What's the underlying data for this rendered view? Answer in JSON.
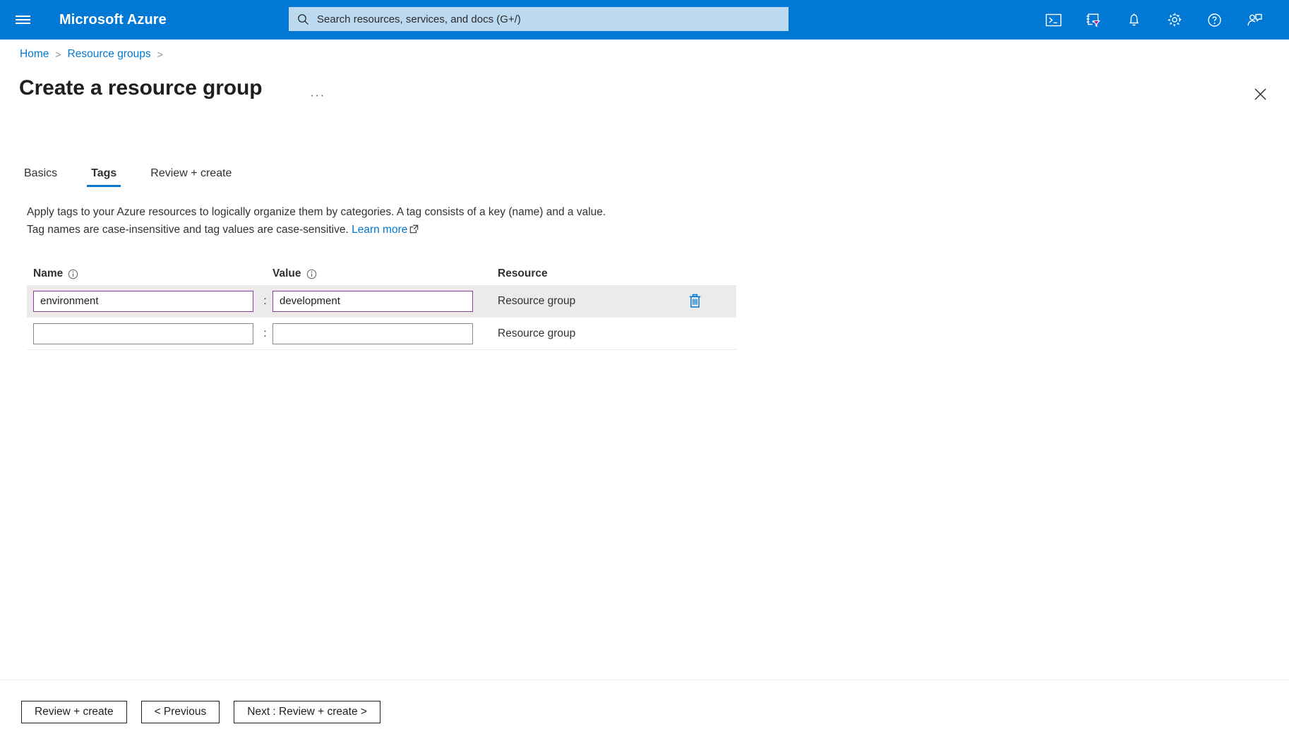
{
  "topbar": {
    "menu_icon": "hamburger-menu-icon",
    "brand": "Microsoft Azure",
    "search": {
      "icon": "search-icon",
      "placeholder": "Search resources, services, and docs (G+/)",
      "value": ""
    },
    "icons": [
      {
        "name": "cloud-shell-icon",
        "title": "Cloud Shell"
      },
      {
        "name": "directories-subscriptions-icon",
        "title": "Directories + subscriptions"
      },
      {
        "name": "notifications-bell-icon",
        "title": "Notifications"
      },
      {
        "name": "settings-gear-icon",
        "title": "Settings"
      },
      {
        "name": "help-question-icon",
        "title": "Help"
      },
      {
        "name": "feedback-person-icon",
        "title": "Feedback"
      }
    ]
  },
  "breadcrumb": {
    "items": [
      {
        "label": "Home"
      },
      {
        "label": "Resource groups"
      }
    ],
    "separator": ">"
  },
  "page": {
    "title": "Create a resource group",
    "ellipsis": "···",
    "close_icon": "close-icon"
  },
  "tabs": [
    {
      "label": "Basics",
      "active": false
    },
    {
      "label": "Tags",
      "active": true
    },
    {
      "label": "Review + create",
      "active": false
    }
  ],
  "description": {
    "line1": "Apply tags to your Azure resources to logically organize them by categories. A tag consists of a key (name) and a value.",
    "line2_before": "Tag names are case-insensitive and tag values are case-sensitive.",
    "link_label": "Learn more",
    "link_icon": "external-link-icon"
  },
  "tag_table": {
    "headers": {
      "name": "Name",
      "name_info_icon": "info-icon",
      "value": "Value",
      "value_info_icon": "info-icon",
      "resource": "Resource"
    },
    "colon": ":",
    "rows": [
      {
        "name_value": "environment",
        "name_placeholder": "",
        "value_value": "development",
        "value_placeholder": "",
        "resource": "Resource group",
        "filled": true,
        "highlighted": true,
        "delete_icon": "delete-trash-icon",
        "has_delete": true
      },
      {
        "name_value": "",
        "name_placeholder": "",
        "value_value": "",
        "value_placeholder": "",
        "resource": "Resource group",
        "filled": false,
        "highlighted": false,
        "delete_icon": "delete-trash-icon",
        "has_delete": false
      }
    ]
  },
  "footer": {
    "buttons": [
      {
        "label": "Review + create",
        "name": "review-create-button"
      },
      {
        "label": "< Previous",
        "name": "previous-button"
      },
      {
        "label": "Next : Review + create >",
        "name": "next-review-create-button"
      }
    ]
  },
  "colors": {
    "azure_blue": "#0078D4",
    "search_bg": "#BBD9EF",
    "input_focus_purple": "#8A3FA0",
    "row_highlight": "#EDEBE9",
    "trash_blue": "#0078D4"
  }
}
